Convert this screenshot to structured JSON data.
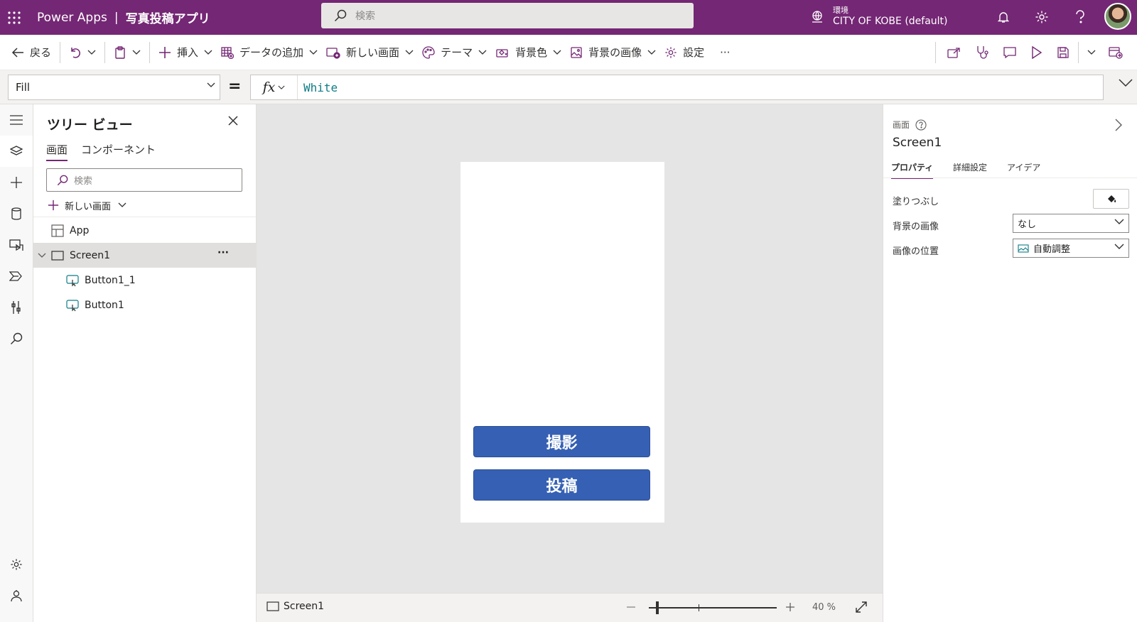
{
  "header": {
    "app_name": "Power Apps",
    "separator": "|",
    "app_title": "写真投稿アプリ",
    "search_placeholder": "検索",
    "environment_label": "環境",
    "environment_name": "CITY OF KOBE (default)"
  },
  "commandbar": {
    "back": "戻る",
    "insert": "挿入",
    "add_data": "データの追加",
    "new_screen": "新しい画面",
    "theme": "テーマ",
    "background_color": "背景色",
    "background_image": "背景の画像",
    "settings": "設定",
    "more": "···"
  },
  "formulabar": {
    "property": "Fill",
    "equals": "=",
    "fx": "fx",
    "formula": "White"
  },
  "tree": {
    "title": "ツリー ビュー",
    "tabs": [
      "画面",
      "コンポーネント"
    ],
    "search_placeholder": "検索",
    "new_screen": "新しい画面",
    "nodes": {
      "app": "App",
      "screen": "Screen1",
      "screen_more": "···",
      "button_a": "Button1_1",
      "button_b": "Button1"
    }
  },
  "canvas": {
    "buttons": [
      "撮影",
      "投稿"
    ]
  },
  "statusbar": {
    "screen": "Screen1",
    "zoom_value": 40,
    "zoom_label": "40 %"
  },
  "properties": {
    "type_label": "画面",
    "name": "Screen1",
    "tabs": [
      "プロパティ",
      "詳細設定",
      "アイデア"
    ],
    "fill_label": "塗りつぶし",
    "fill_value": "#ffffff",
    "bg_image_label": "背景の画像",
    "bg_image_value": "なし",
    "image_position_label": "画像の位置",
    "image_position_value": "自動調整"
  },
  "colors": {
    "brand": "#742774",
    "button": "#3660b3",
    "formula_text": "#0e7c86"
  }
}
